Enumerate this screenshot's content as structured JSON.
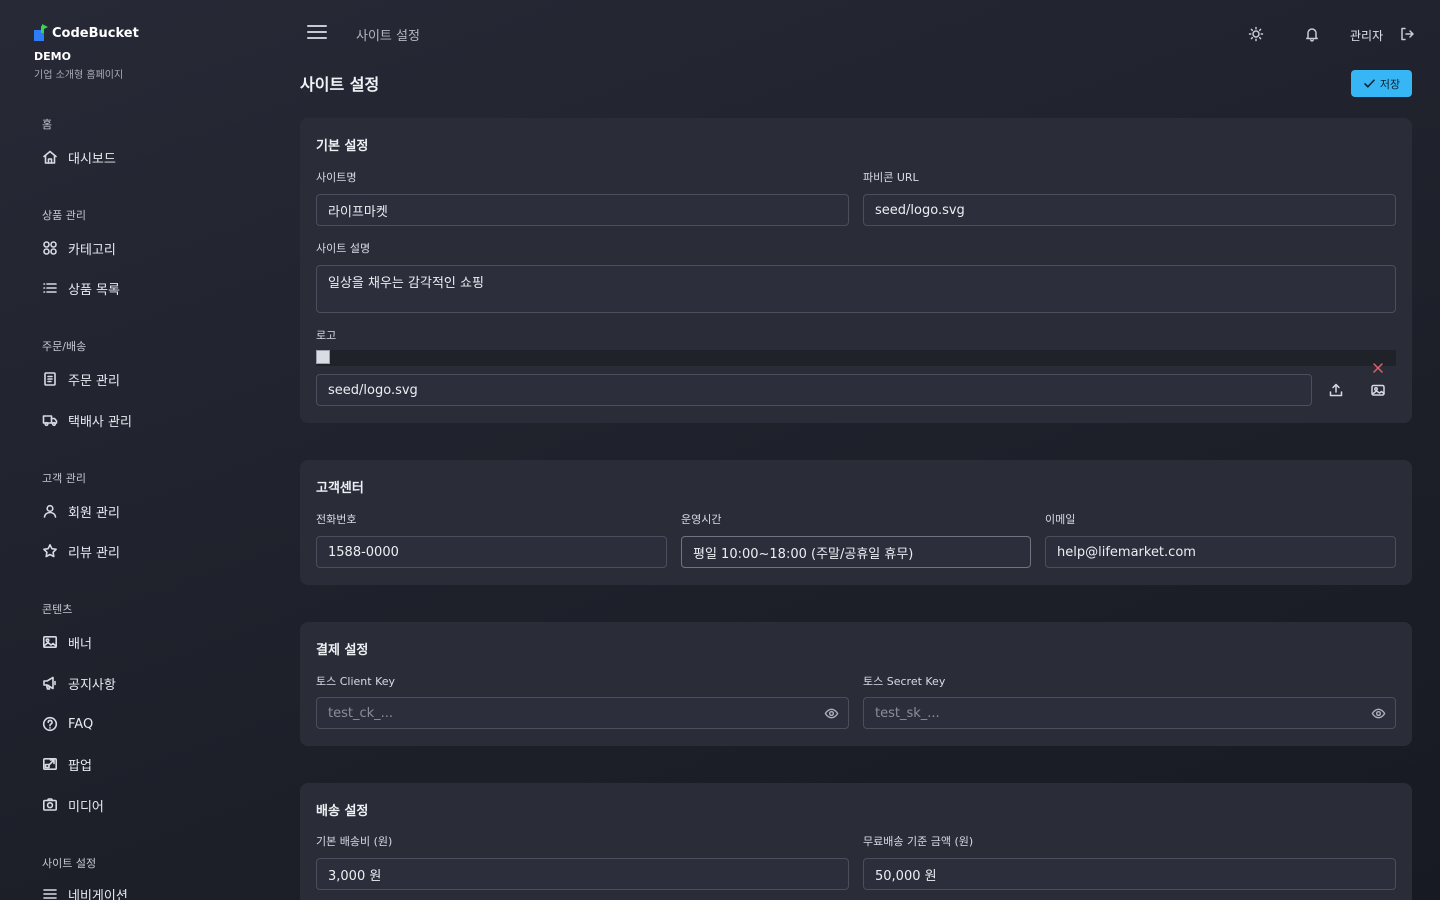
{
  "brand": {
    "name": "CodeBucket",
    "demo": "DEMO",
    "subtitle": "기업 소개형 홈페이지"
  },
  "sidebar": {
    "sections": [
      {
        "label": "홈"
      },
      {
        "label": "상품 관리"
      },
      {
        "label": "주문/배송"
      },
      {
        "label": "고객 관리"
      },
      {
        "label": "콘텐츠"
      },
      {
        "label": "사이트 설정"
      }
    ],
    "items": [
      {
        "label": "대시보드",
        "icon": "home-icon"
      },
      {
        "label": "카테고리",
        "icon": "grid-icon"
      },
      {
        "label": "상품 목록",
        "icon": "list-icon"
      },
      {
        "label": "주문 관리",
        "icon": "receipt-icon"
      },
      {
        "label": "택배사 관리",
        "icon": "truck-icon"
      },
      {
        "label": "회원 관리",
        "icon": "user-icon"
      },
      {
        "label": "리뷰 관리",
        "icon": "star-icon"
      },
      {
        "label": "배너",
        "icon": "image-icon"
      },
      {
        "label": "공지사항",
        "icon": "megaphone-icon"
      },
      {
        "label": "FAQ",
        "icon": "help-circle-icon"
      },
      {
        "label": "팝업",
        "icon": "popup-icon"
      },
      {
        "label": "미디어",
        "icon": "media-icon"
      },
      {
        "label": "네비게이션",
        "icon": "menu-icon"
      }
    ]
  },
  "topbar": {
    "breadcrumb": "사이트 설정",
    "user": "관리자"
  },
  "page": {
    "title": "사이트 설정",
    "save_label": "저장"
  },
  "basic": {
    "title": "기본 설정",
    "site_name_label": "사이트명",
    "site_name": "라이프마켓",
    "favicon_label": "파비콘 URL",
    "favicon": "seed/logo.svg",
    "desc_label": "사이트 설명",
    "desc": "일상을 채우는 감각적인 쇼핑",
    "logo_label": "로고",
    "logo": "seed/logo.svg"
  },
  "support": {
    "title": "고객센터",
    "phone_label": "전화번호",
    "phone": "1588-0000",
    "hours_label": "운영시간",
    "hours": "평일 10:00~18:00 (주말/공휴일 휴무)",
    "email_label": "이메일",
    "email": "help@lifemarket.com"
  },
  "payment": {
    "title": "결제 설정",
    "client_label": "토스 Client Key",
    "client_placeholder": "test_ck_...",
    "secret_label": "토스 Secret Key",
    "secret_placeholder": "test_sk_..."
  },
  "shipping": {
    "title": "배송 설정",
    "fee_label": "기본 배송비 (원)",
    "fee": "3,000 원",
    "free_label": "무료배송 기준 금액 (원)",
    "free": "50,000 원"
  },
  "colors": {
    "accent": "#37b6f5",
    "danger": "#e0606a",
    "brand_green": "#3ecf5a",
    "brand_blue": "#2f7df6"
  }
}
